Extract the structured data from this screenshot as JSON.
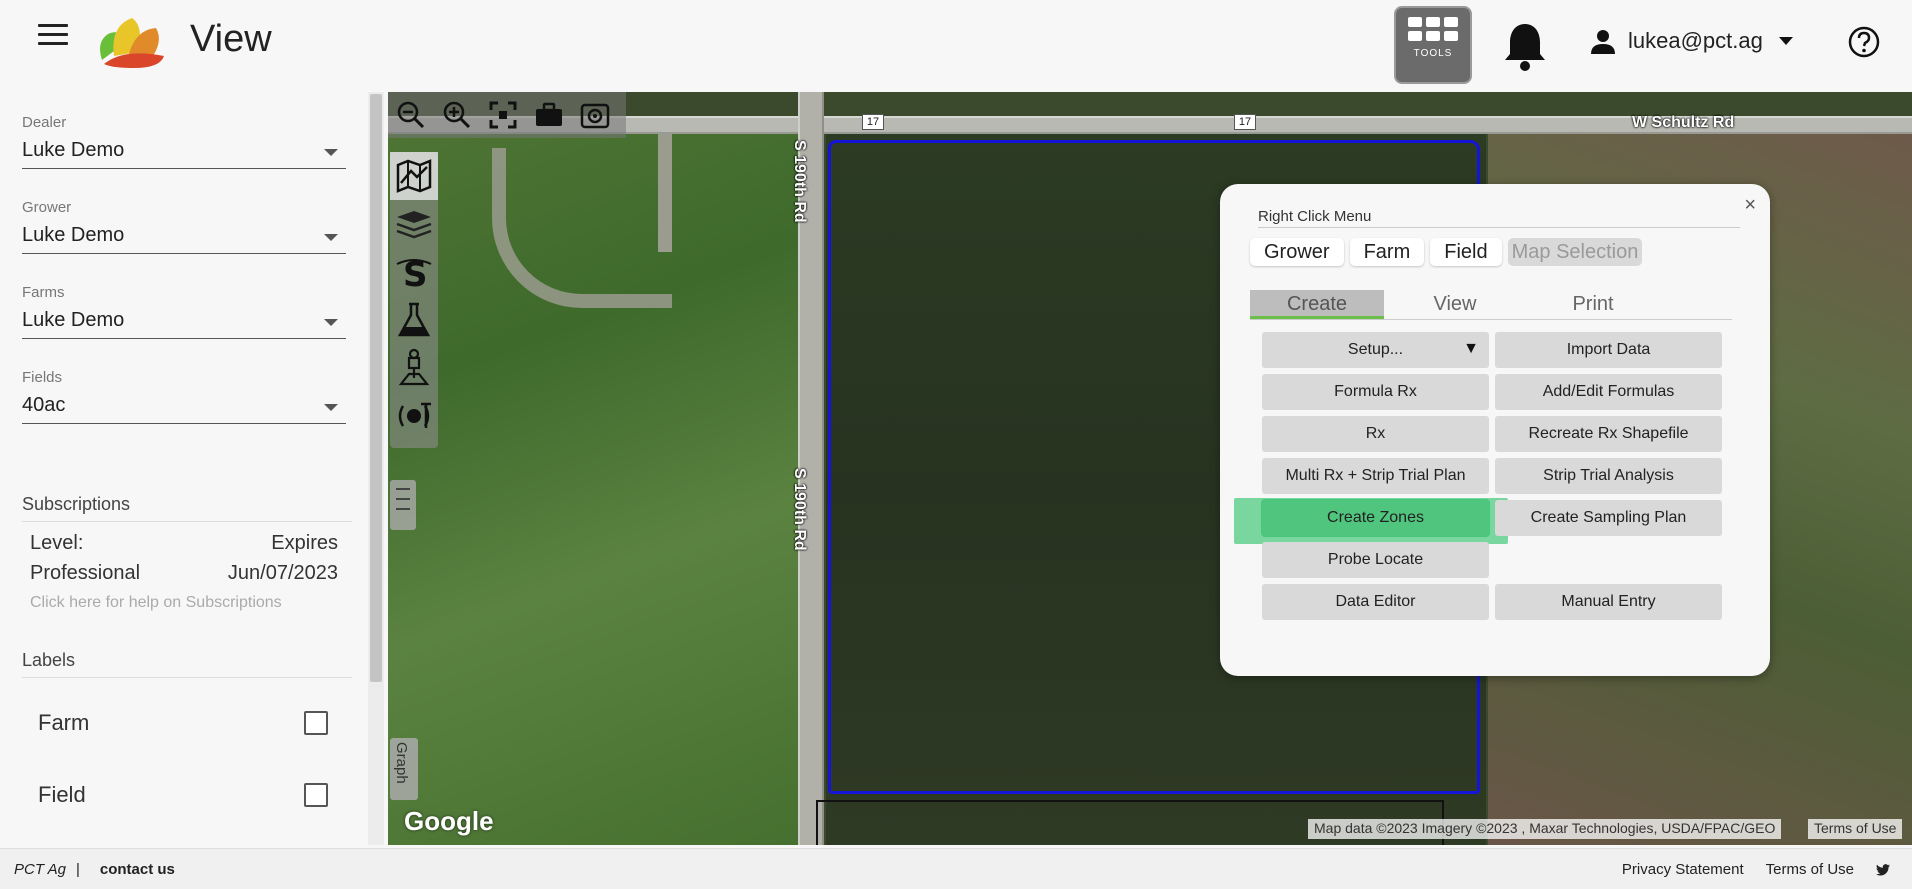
{
  "header": {
    "title": "View",
    "tools_label": "TOOLS",
    "user_email": "lukea@pct.ag"
  },
  "sidebar": {
    "dealer": {
      "label": "Dealer",
      "value": "Luke Demo"
    },
    "grower": {
      "label": "Grower",
      "value": "Luke Demo"
    },
    "farms": {
      "label": "Farms",
      "value": "Luke Demo"
    },
    "fields": {
      "label": "Fields",
      "value": "40ac"
    },
    "subscriptions": {
      "heading": "Subscriptions",
      "level_label": "Level:",
      "expires_label": "Expires",
      "level_value": "Professional",
      "expires_value": "Jun/07/2023",
      "help_text": "Click here for help on Subscriptions"
    },
    "labels": {
      "heading": "Labels",
      "items": [
        {
          "label": "Farm",
          "checked": false
        },
        {
          "label": "Field",
          "checked": false
        }
      ]
    }
  },
  "map": {
    "route_shield_1": "17",
    "route_shield_2": "17",
    "road_h": "W Schultz Rd",
    "road_v_1": "S 190th Rd",
    "road_v_2": "S 190th Rd",
    "graph_tab": "Graph",
    "google": "Google",
    "attribution": "Map data ©2023 Imagery ©2023 , Maxar Technologies, USDA/FPAC/GEO",
    "terms": "Terms of Use",
    "boundary_color": "#1515d8"
  },
  "dialog": {
    "close": "×",
    "title": "Right Click Menu",
    "context_tabs": [
      "Grower",
      "Farm",
      "Field",
      "Map Selection"
    ],
    "mode_tabs": [
      "Create",
      "View",
      "Print"
    ],
    "actions": {
      "setup": "Setup...",
      "setup_caret": "▼",
      "import_data": "Import Data",
      "formula_rx": "Formula Rx",
      "add_edit_formulas": "Add/Edit Formulas",
      "rx": "Rx",
      "recreate_rx": "Recreate Rx Shapefile",
      "multi_rx": "Multi Rx + Strip Trial Plan",
      "strip_trial": "Strip Trial Analysis",
      "create_zones": "Create Zones",
      "create_sampling": "Create Sampling Plan",
      "probe_locate": "Probe Locate",
      "data_editor": "Data Editor",
      "manual_entry": "Manual Entry"
    },
    "highlight_color": "#42c878"
  },
  "footer": {
    "brand": "PCT Ag",
    "separator": "|",
    "contact": "contact us",
    "privacy": "Privacy Statement",
    "terms": "Terms of Use"
  }
}
